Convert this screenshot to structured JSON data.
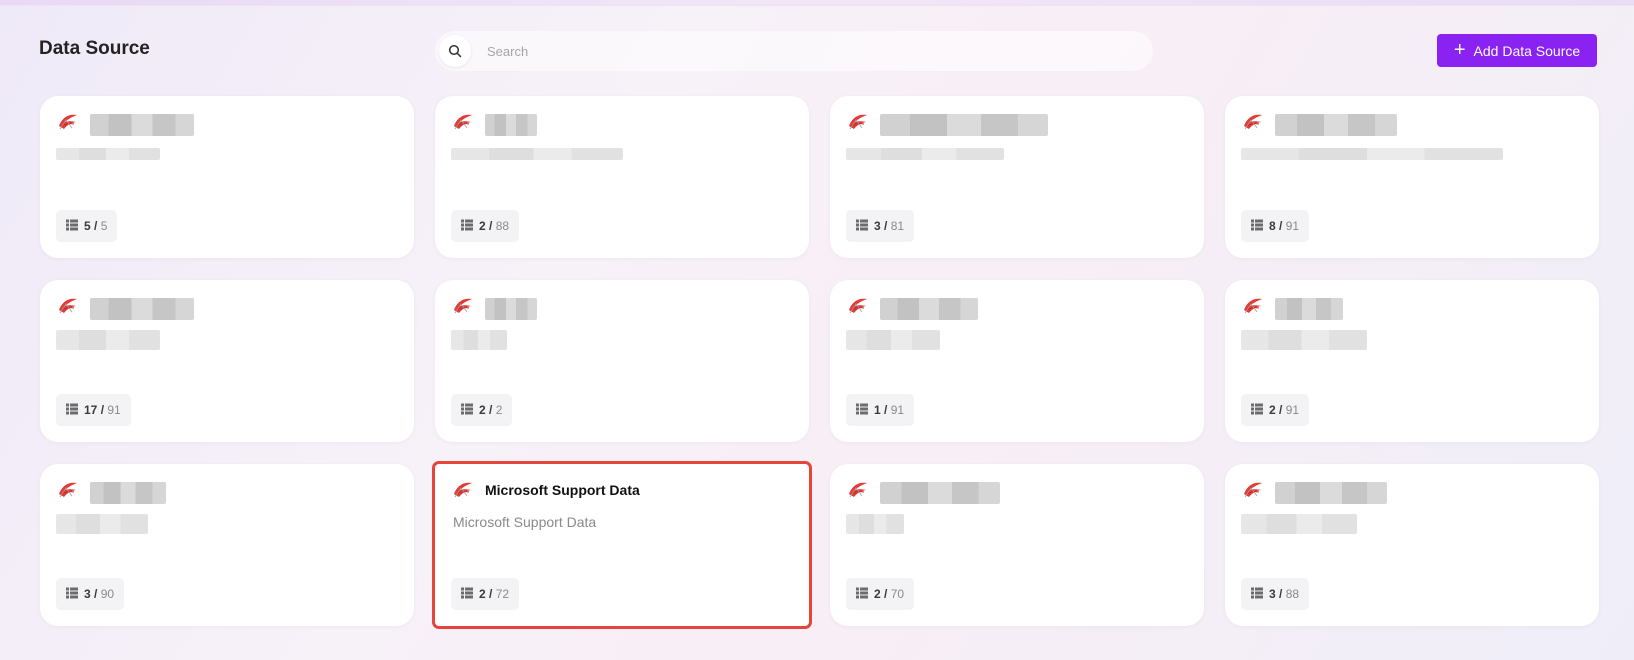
{
  "header": {
    "title": "Data Source",
    "search_placeholder": "Search",
    "add_button_label": "Add Data Source",
    "search_icon": "search-icon",
    "plus_icon": "plus-icon"
  },
  "colors": {
    "accent": "#8a22f2",
    "selected_outline": "#e5453a"
  },
  "cards": [
    {
      "title": "",
      "description": "",
      "blurred": true,
      "selected": false,
      "count_used": "5",
      "count_total": "5"
    },
    {
      "title": "",
      "description": "",
      "blurred": true,
      "selected": false,
      "count_used": "2",
      "count_total": "88"
    },
    {
      "title": "",
      "description": "",
      "blurred": true,
      "selected": false,
      "count_used": "3",
      "count_total": "81"
    },
    {
      "title": "",
      "description": "",
      "blurred": true,
      "selected": false,
      "count_used": "8",
      "count_total": "91"
    },
    {
      "title": "",
      "description": "",
      "blurred": true,
      "selected": false,
      "count_used": "17",
      "count_total": "91"
    },
    {
      "title": "",
      "description": "",
      "blurred": true,
      "selected": false,
      "count_used": "2",
      "count_total": "2"
    },
    {
      "title": "",
      "description": "",
      "blurred": true,
      "selected": false,
      "count_used": "1",
      "count_total": "91"
    },
    {
      "title": "",
      "description": "",
      "blurred": true,
      "selected": false,
      "count_used": "2",
      "count_total": "91"
    },
    {
      "title": "",
      "description": "",
      "blurred": true,
      "selected": false,
      "count_used": "3",
      "count_total": "90"
    },
    {
      "title": "Microsoft Support Data",
      "description": "Microsoft Support Data",
      "blurred": false,
      "selected": true,
      "count_used": "2",
      "count_total": "72"
    },
    {
      "title": "",
      "description": "",
      "blurred": true,
      "selected": false,
      "count_used": "2",
      "count_total": "70"
    },
    {
      "title": "",
      "description": "",
      "blurred": true,
      "selected": false,
      "count_used": "3",
      "count_total": "88"
    }
  ],
  "icons": {
    "card_logo": "sql-server-icon",
    "count_icon": "table-list-icon"
  }
}
